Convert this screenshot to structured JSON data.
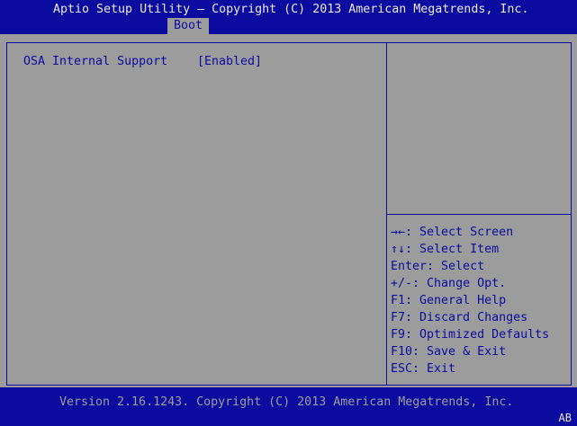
{
  "header": {
    "title": "Aptio Setup Utility – Copyright (C) 2013 American Megatrends, Inc.",
    "tabs": [
      {
        "label": "Boot",
        "active": true
      }
    ]
  },
  "options": [
    {
      "label": "OSA Internal Support",
      "value": "[Enabled]"
    }
  ],
  "help": [
    {
      "key": "→←",
      "text": ": Select Screen"
    },
    {
      "key": "↑↓",
      "text": ": Select Item"
    },
    {
      "key": "Enter",
      "text": ": Select"
    },
    {
      "key": "+/-",
      "text": ": Change Opt."
    },
    {
      "key": "F1",
      "text": ": General Help"
    },
    {
      "key": "F7",
      "text": ": Discard Changes"
    },
    {
      "key": "F9",
      "text": ": Optimized Defaults"
    },
    {
      "key": "F10",
      "text": ": Save & Exit"
    },
    {
      "key": "ESC",
      "text": ": Exit"
    }
  ],
  "footer": {
    "version": "Version 2.16.1243. Copyright (C) 2013 American Megatrends, Inc.",
    "indicator": "AB"
  },
  "colors": {
    "blue": "#0b0ba0",
    "gray": "#9c9c9c"
  }
}
